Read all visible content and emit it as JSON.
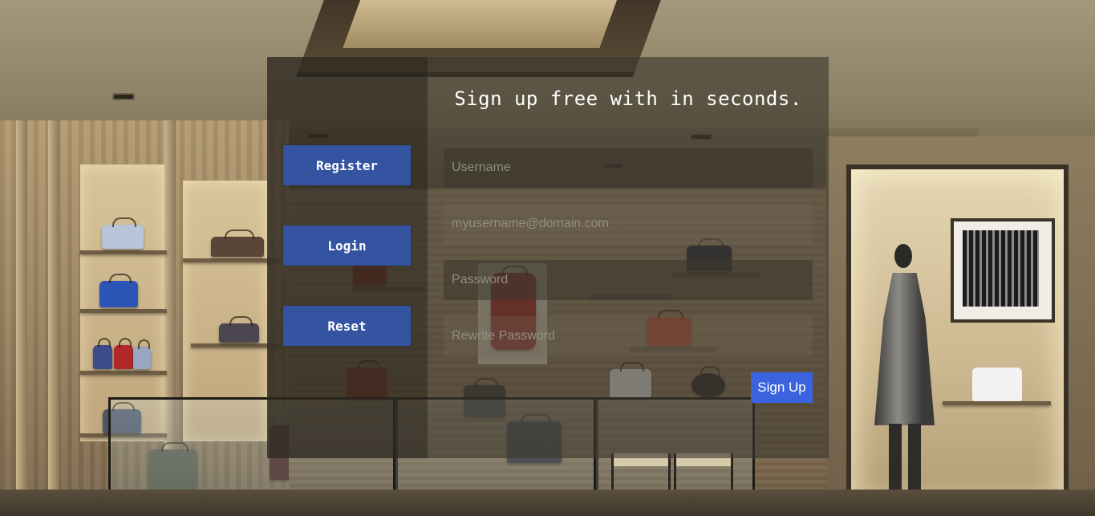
{
  "page": {
    "heading": "Sign up free with in seconds."
  },
  "sidebar": {
    "buttons": [
      {
        "label": "Register"
      },
      {
        "label": "Login"
      },
      {
        "label": "Reset"
      }
    ]
  },
  "form": {
    "username": {
      "value": "",
      "placeholder": "Username"
    },
    "email": {
      "value": "",
      "placeholder": "myusername@domain.com"
    },
    "password": {
      "value": "",
      "placeholder": "Password"
    },
    "rewrite_password": {
      "value": "",
      "placeholder": "Rewrite Password"
    },
    "submit_label": "Sign Up"
  },
  "colors": {
    "side_button": "#3453a1",
    "submit_button": "#3b63e0",
    "text": "#ffffff"
  }
}
